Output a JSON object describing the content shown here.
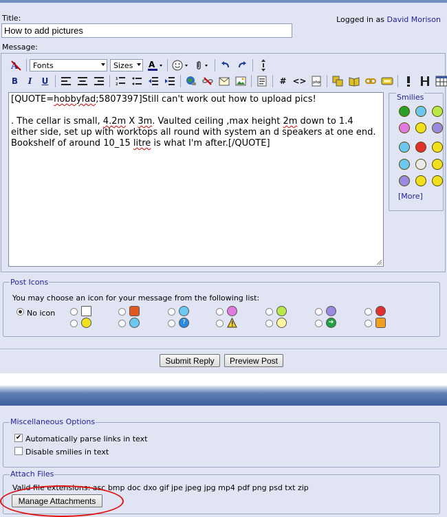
{
  "header": {
    "logged_in_prefix": "Logged in as",
    "user": "David Morison"
  },
  "title_field": {
    "label": "Title:",
    "value": "How to add pictures"
  },
  "message_field": {
    "label": "Message:"
  },
  "toolbar": {
    "fonts": "Fonts",
    "sizes": "Sizes"
  },
  "message": {
    "line1": "[QUOTE=",
    "line1_sq": "hobbyfad",
    "line1_rest": ";5807397]Still can't work out how to upload pics!",
    "p2_a": ". The cellar is small, ",
    "p2_b": "4.2m",
    "p2_c": " X ",
    "p2_d": "3m",
    "p2_e": ". Vaulted ceiling ,max height ",
    "p2_f": "2m",
    "p2_g": " down to 1.4 either side, set up with worktops all round with system an d speakers at one end. Bookshelf of around 10_15 ",
    "p2_h": "litre",
    "p2_i": " is what I'm after.[/QUOTE]"
  },
  "smilies": {
    "legend": "Smilies",
    "more": "[More]"
  },
  "post_icons": {
    "legend": "Post Icons",
    "instruction": "You may choose an icon for your message from the following list:",
    "no_icon": "No icon"
  },
  "buttons": {
    "submit": "Submit Reply",
    "preview": "Preview Post"
  },
  "misc": {
    "legend": "Miscellaneous Options",
    "parse_links": "Automatically parse links in text",
    "disable_smilies": "Disable smilies in text"
  },
  "attach": {
    "legend": "Attach Files",
    "extensions": "Valid file extensions: asc bmp doc dxo gif jpe jpeg jpg mp4 pdf png psd txt zip",
    "manage": "Manage Attachments"
  },
  "colors": {
    "panel": "#e1e4f2",
    "link": "#22229c",
    "highlight": "#e01010"
  }
}
